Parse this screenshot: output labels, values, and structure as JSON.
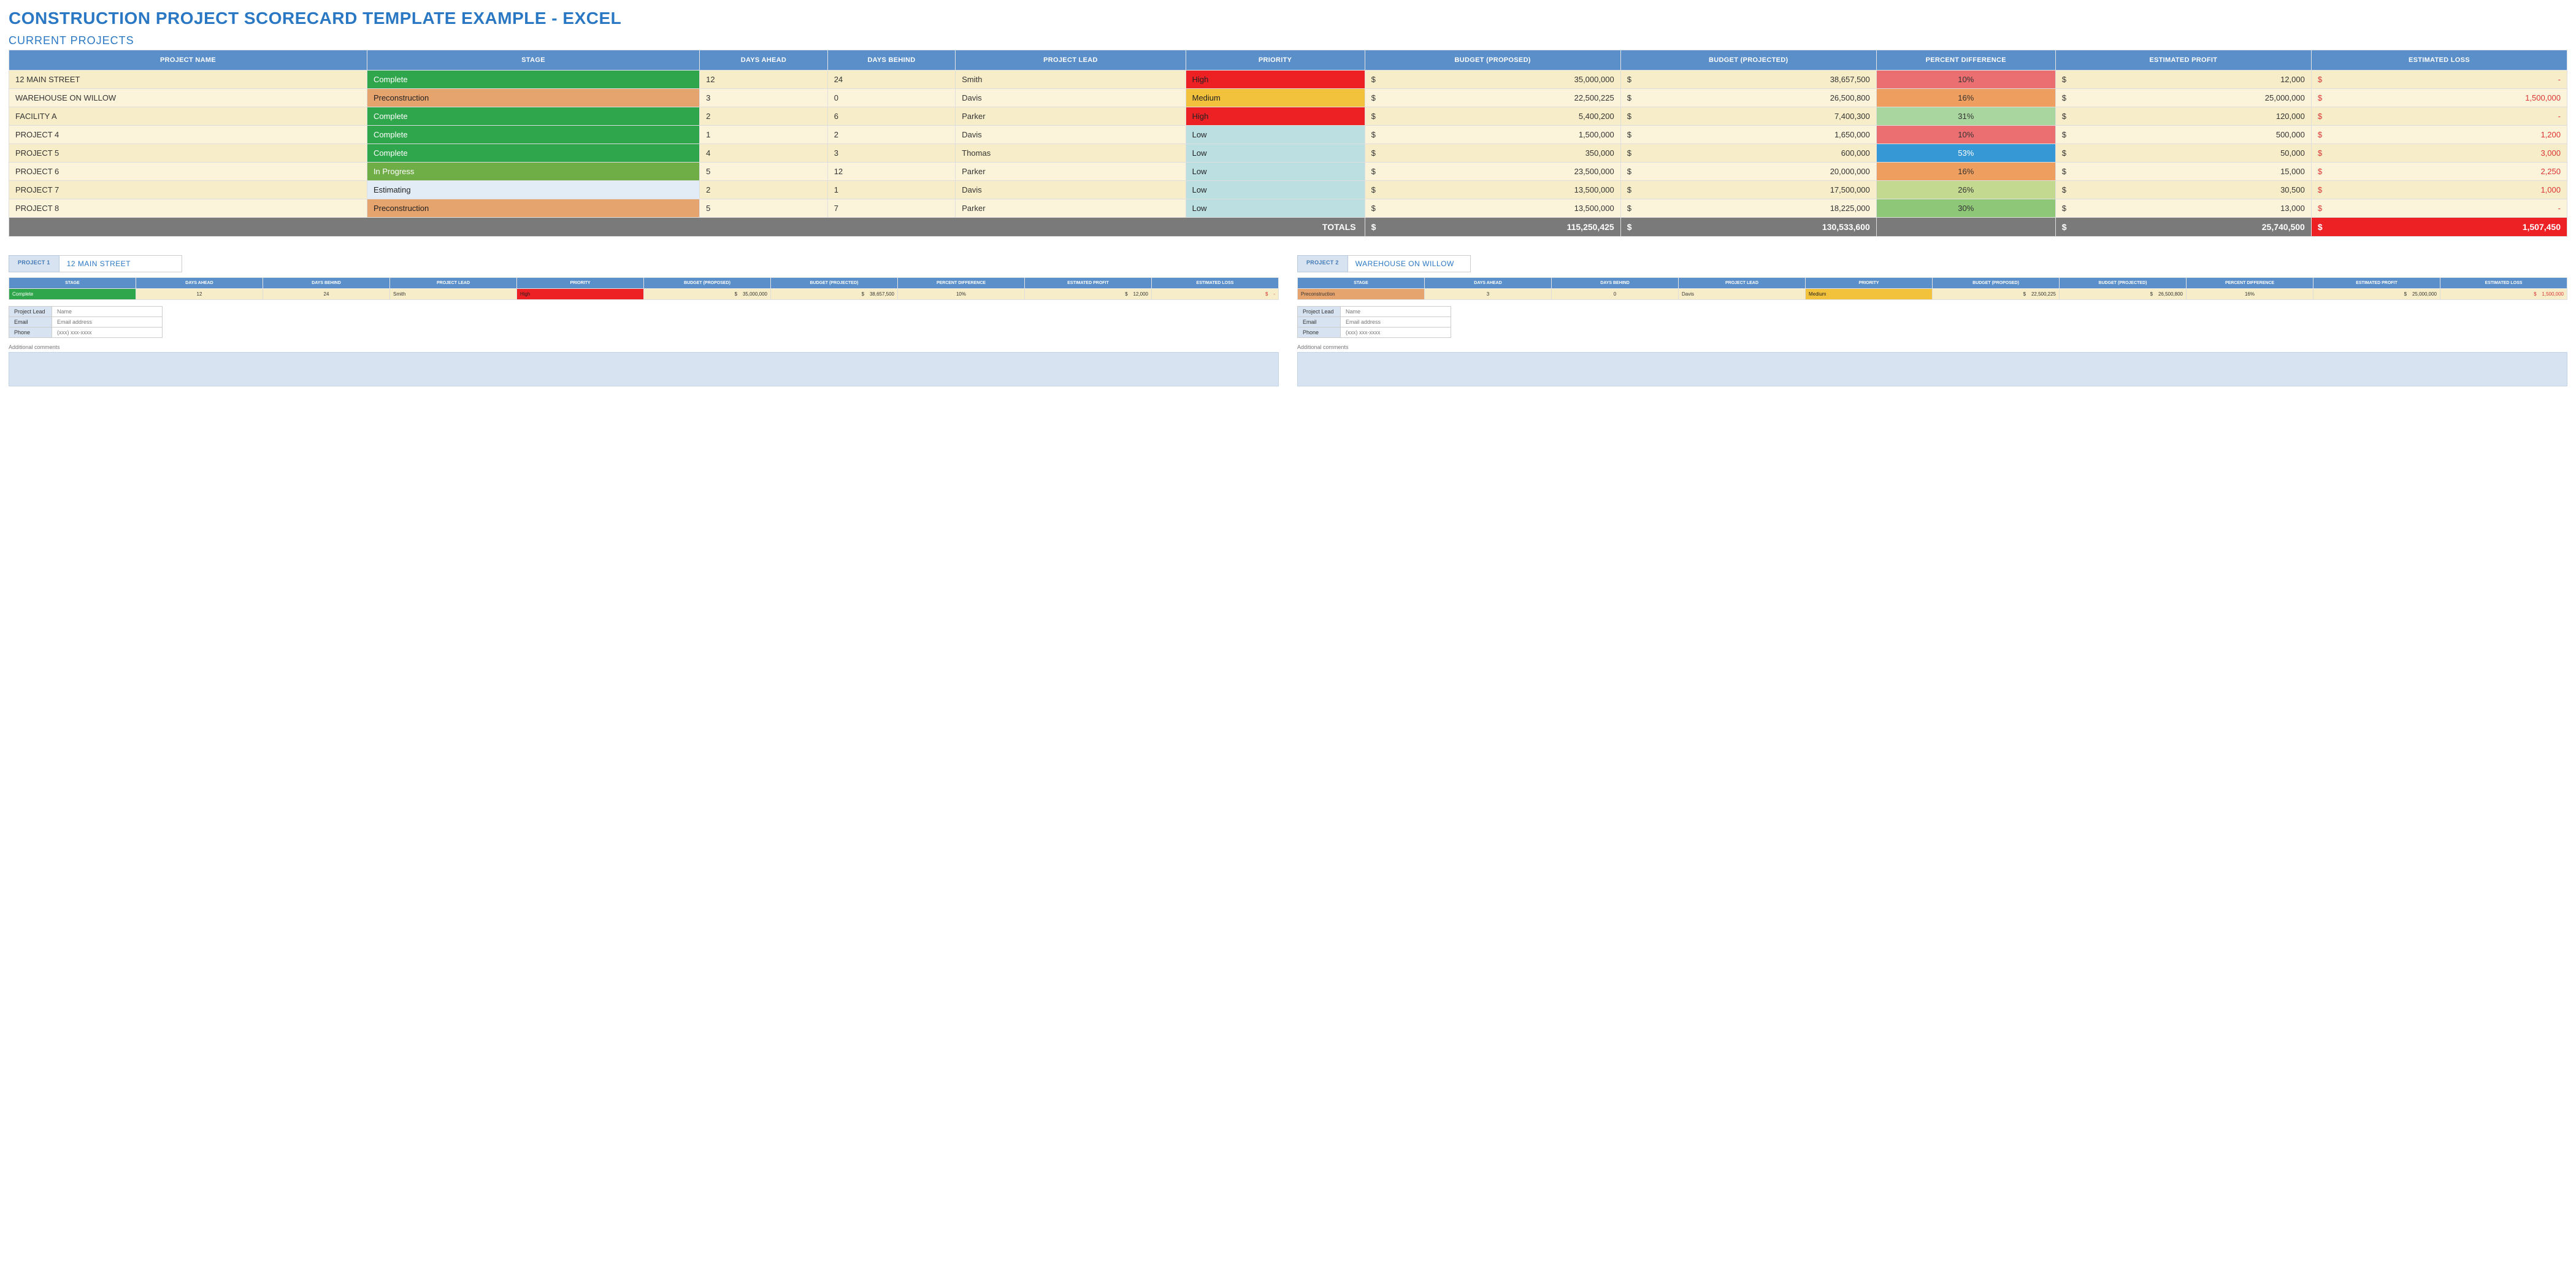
{
  "title": "CONSTRUCTION PROJECT SCORECARD TEMPLATE EXAMPLE - EXCEL",
  "section": "CURRENT PROJECTS",
  "headers": {
    "name": "PROJECT NAME",
    "stage": "STAGE",
    "daysAhead": "DAYS AHEAD",
    "daysBehind": "DAYS BEHIND",
    "lead": "PROJECT LEAD",
    "priority": "PRIORITY",
    "budgetProp": "BUDGET (PROPOSED)",
    "budgetProj": "BUDGET (PROJECTED)",
    "pctDiff": "PERCENT DIFFERENCE",
    "profit": "ESTIMATED PROFIT",
    "loss": "ESTIMATED LOSS"
  },
  "rows": [
    {
      "name": "12 MAIN STREET",
      "stage": "Complete",
      "stageClass": "stage-complete",
      "daysAhead": "12",
      "daysBehind": "24",
      "lead": "Smith",
      "priority": "High",
      "priClass": "pri-high",
      "budgetProp": "35,000,000",
      "budgetProj": "38,657,500",
      "pct": "10%",
      "pctClass": "pct-red",
      "profit": "12,000",
      "loss": "-"
    },
    {
      "name": "WAREHOUSE ON WILLOW",
      "stage": "Preconstruction",
      "stageClass": "stage-preconstruction",
      "daysAhead": "3",
      "daysBehind": "0",
      "lead": "Davis",
      "priority": "Medium",
      "priClass": "pri-medium",
      "budgetProp": "22,500,225",
      "budgetProj": "26,500,800",
      "pct": "16%",
      "pctClass": "pct-orange",
      "profit": "25,000,000",
      "loss": "1,500,000"
    },
    {
      "name": "FACILITY A",
      "stage": "Complete",
      "stageClass": "stage-complete",
      "daysAhead": "2",
      "daysBehind": "6",
      "lead": "Parker",
      "priority": "High",
      "priClass": "pri-high",
      "budgetProp": "5,400,200",
      "budgetProj": "7,400,300",
      "pct": "31%",
      "pctClass": "pct-lgreen",
      "profit": "120,000",
      "loss": "-"
    },
    {
      "name": "PROJECT 4",
      "stage": "Complete",
      "stageClass": "stage-complete",
      "daysAhead": "1",
      "daysBehind": "2",
      "lead": "Davis",
      "priority": "Low",
      "priClass": "pri-low",
      "budgetProp": "1,500,000",
      "budgetProj": "1,650,000",
      "pct": "10%",
      "pctClass": "pct-red",
      "profit": "500,000",
      "loss": "1,200"
    },
    {
      "name": "PROJECT 5",
      "stage": "Complete",
      "stageClass": "stage-complete",
      "daysAhead": "4",
      "daysBehind": "3",
      "lead": "Thomas",
      "priority": "Low",
      "priClass": "pri-low",
      "budgetProp": "350,000",
      "budgetProj": "600,000",
      "pct": "53%",
      "pctClass": "pct-blue",
      "profit": "50,000",
      "loss": "3,000"
    },
    {
      "name": "PROJECT 6",
      "stage": "In Progress",
      "stageClass": "stage-inprogress",
      "daysAhead": "5",
      "daysBehind": "12",
      "lead": "Parker",
      "priority": "Low",
      "priClass": "pri-low",
      "budgetProp": "23,500,000",
      "budgetProj": "20,000,000",
      "pct": "16%",
      "pctClass": "pct-orange",
      "profit": "15,000",
      "loss": "2,250"
    },
    {
      "name": "PROJECT 7",
      "stage": "Estimating",
      "stageClass": "stage-estimating",
      "daysAhead": "2",
      "daysBehind": "1",
      "lead": "Davis",
      "priority": "Low",
      "priClass": "pri-low",
      "budgetProp": "13,500,000",
      "budgetProj": "17,500,000",
      "pct": "26%",
      "pctClass": "pct-ygreen",
      "profit": "30,500",
      "loss": "1,000"
    },
    {
      "name": "PROJECT 8",
      "stage": "Preconstruction",
      "stageClass": "stage-preconstruction",
      "daysAhead": "5",
      "daysBehind": "7",
      "lead": "Parker",
      "priority": "Low",
      "priClass": "pri-low",
      "budgetProp": "13,500,000",
      "budgetProj": "18,225,000",
      "pct": "30%",
      "pctClass": "pct-green2",
      "profit": "13,000",
      "loss": "-"
    }
  ],
  "totals": {
    "label": "TOTALS",
    "budgetProp": "115,250,425",
    "budgetProj": "130,533,600",
    "profit": "25,740,500",
    "loss": "1,507,450"
  },
  "cards": [
    {
      "tag": "PROJECT 1",
      "name": "12 MAIN STREET",
      "row": {
        "stage": "Complete",
        "stageClass": "stage-complete",
        "daysAhead": "12",
        "daysBehind": "24",
        "lead": "Smith",
        "priority": "High",
        "priClass": "pri-high",
        "budgetProp": "35,000,000",
        "budgetProj": "38,657,500",
        "pct": "10%",
        "profit": "12,000",
        "loss": "-"
      }
    },
    {
      "tag": "PROJECT 2",
      "name": "WAREHOUSE ON WILLOW",
      "row": {
        "stage": "Preconstruction",
        "stageClass": "stage-preconstruction",
        "daysAhead": "3",
        "daysBehind": "0",
        "lead": "Davis",
        "priority": "Medium",
        "priClass": "pri-medium",
        "budgetProp": "22,500,225",
        "budgetProj": "26,500,800",
        "pct": "16%",
        "profit": "25,000,000",
        "loss": "1,500,000"
      }
    }
  ],
  "contact": {
    "leadLabel": "Project Lead",
    "leadPlaceholder": "Name",
    "emailLabel": "Email",
    "emailPlaceholder": "Email address",
    "phoneLabel": "Phone",
    "phonePlaceholder": "(xxx) xxx-xxxx"
  },
  "commentsLabel": "Additional comments",
  "currency": "$"
}
